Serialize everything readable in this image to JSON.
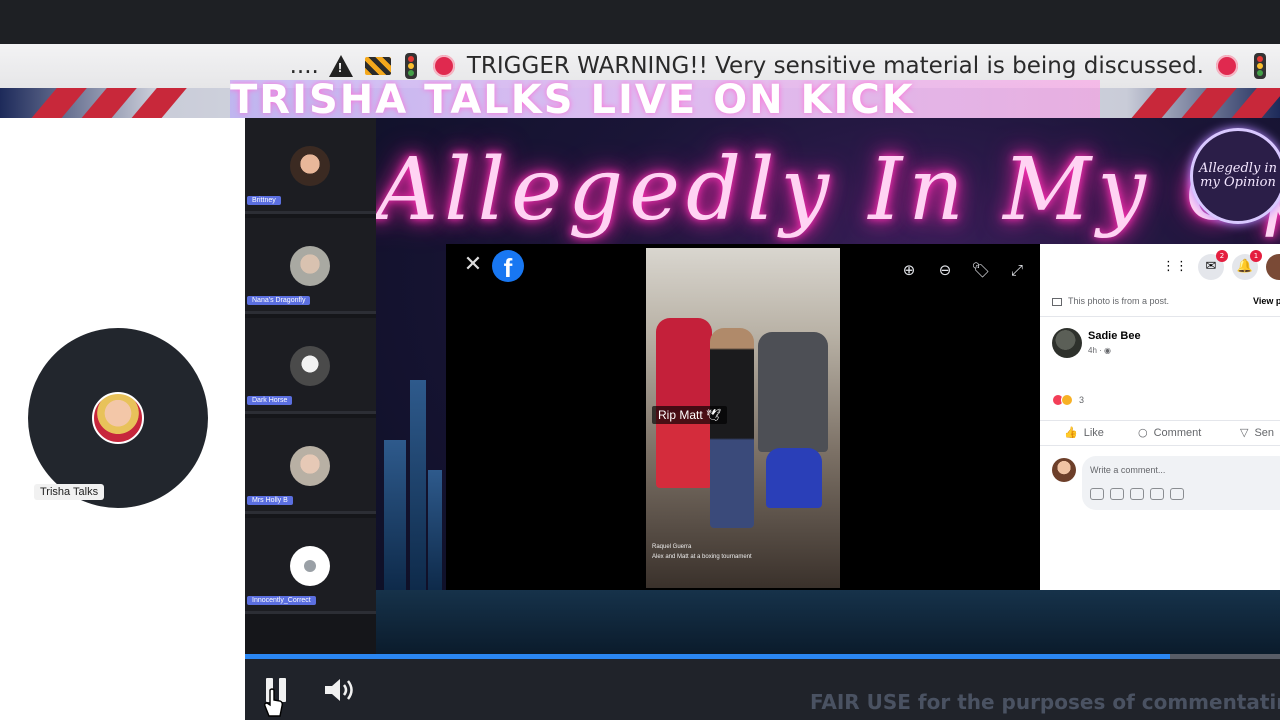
{
  "ticker": {
    "lead": "....",
    "message": "TRIGGER WARNING!! Very sensitive material is being discussed."
  },
  "banner": {
    "title": "TRISHA TALKS LIVE ON KICK"
  },
  "show": {
    "script_title": "Allegedly In My Opinion",
    "badge": "Allegedly in my Opinion"
  },
  "host": {
    "label": "Trisha Talks"
  },
  "participants": [
    {
      "name": "Brittney",
      "avatar_color": "#3b2a22"
    },
    {
      "name": "Nana's Dragonfly",
      "avatar_color": "#a9a9a2"
    },
    {
      "name": "Dark Horse",
      "avatar_color": "#4a4a4a"
    },
    {
      "name": "Mrs Holly B",
      "avatar_color": "#b8b0a4"
    },
    {
      "name": "Innocently_Correct",
      "avatar_color": "#ffffff"
    }
  ],
  "facebook": {
    "close_icon": "close-icon",
    "logo": "f",
    "tools": [
      "zoom-in-icon",
      "zoom-out-icon",
      "tag-icon",
      "fullscreen-icon"
    ],
    "photo": {
      "overlay_text": "Rip Matt 🕊",
      "caption_name": "Raquel Guerra",
      "caption_text": "Alex and Matt at a boxing tournament"
    },
    "side": {
      "notice": "This photo is from a post.",
      "view_post": "View p",
      "author": "Sadie Bee",
      "time": "4h · ◉",
      "reaction_count": "3",
      "actions": {
        "like": "Like",
        "comment": "Comment",
        "send": "Sen"
      },
      "comment_placeholder": "Write a comment...",
      "badges": {
        "messenger": "2",
        "notifications": "1"
      }
    }
  },
  "player": {
    "progress": 0.894,
    "fair_use": "FAIR USE for the purposes of commentating"
  },
  "colors": {
    "fb_blue": "#1877f2",
    "progress": "#2a86f2",
    "warning_red": "#e0294f"
  }
}
